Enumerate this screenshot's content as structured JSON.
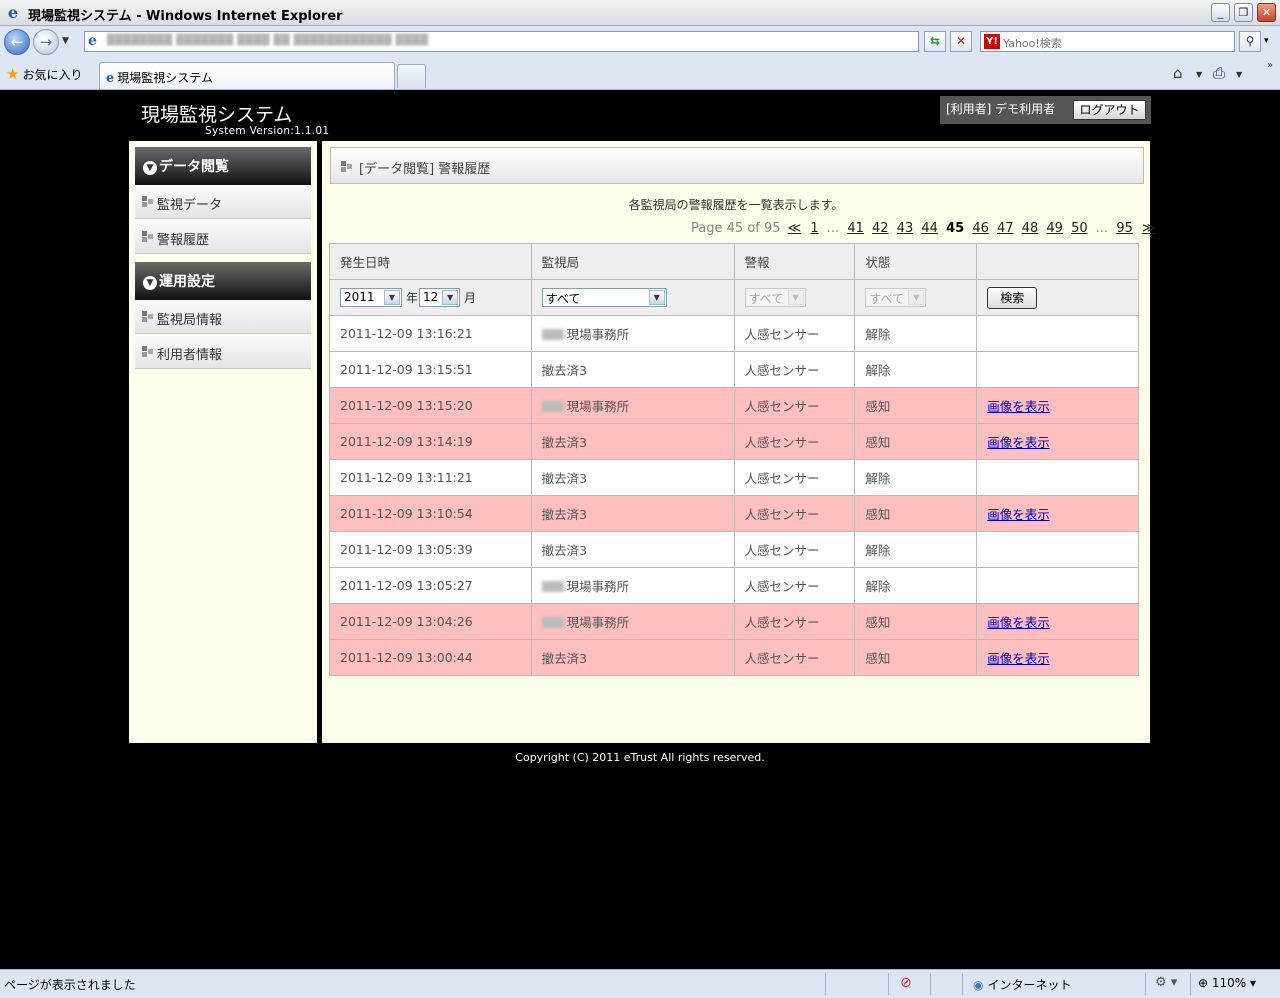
{
  "browser": {
    "window_title": "現場監視システム - Windows Internet Explorer",
    "search_placeholder": "Yahoo!検索",
    "favorites_label": "お気に入り",
    "tab_title": "現場監視システム",
    "status_text": "ページが表示されました",
    "zone_label": "インターネット",
    "zoom_label": "110%"
  },
  "header": {
    "title": "現場監視システム",
    "version": "System Version:1.1.01",
    "user_label": "[利用者] デモ利用者",
    "logout_label": "ログアウト"
  },
  "sidebar": {
    "sections": [
      {
        "title": "データ閲覧",
        "items": [
          "監視データ",
          "警報履歴"
        ]
      },
      {
        "title": "運用設定",
        "items": [
          "監視局情報",
          "利用者情報"
        ]
      }
    ]
  },
  "content": {
    "header": "[データ閲覧] 警報履歴",
    "description": "各監視局の警報履歴を一覧表示します。",
    "pager": {
      "summary": "Page 45 of 95",
      "prev_symbol": "≪",
      "next_symbol": "≫",
      "first": "1",
      "ellipsis": "...",
      "before": [
        "41",
        "42",
        "43",
        "44"
      ],
      "current": "45",
      "after": [
        "46",
        "47",
        "48",
        "49",
        "50"
      ],
      "last": "95"
    },
    "table": {
      "columns": [
        "発生日時",
        "監視局",
        "警報",
        "状態",
        ""
      ],
      "filters": {
        "year": "2011",
        "year_unit": "年",
        "month": "12",
        "month_unit": "月",
        "station": "すべて",
        "alarm": "すべて",
        "state": "すべて",
        "search_button": "検索"
      },
      "rows": [
        {
          "datetime": "2011-12-09 13:16:21",
          "station": "現場事務所",
          "station_masked": true,
          "alarm": "人感センサー",
          "state": "解除",
          "link": "",
          "alert": false
        },
        {
          "datetime": "2011-12-09 13:15:51",
          "station": "撤去済3",
          "station_masked": false,
          "alarm": "人感センサー",
          "state": "解除",
          "link": "",
          "alert": false
        },
        {
          "datetime": "2011-12-09 13:15:20",
          "station": "現場事務所",
          "station_masked": true,
          "alarm": "人感センサー",
          "state": "感知",
          "link": "画像を表示",
          "alert": true
        },
        {
          "datetime": "2011-12-09 13:14:19",
          "station": "撤去済3",
          "station_masked": false,
          "alarm": "人感センサー",
          "state": "感知",
          "link": "画像を表示",
          "alert": true
        },
        {
          "datetime": "2011-12-09 13:11:21",
          "station": "撤去済3",
          "station_masked": false,
          "alarm": "人感センサー",
          "state": "解除",
          "link": "",
          "alert": false
        },
        {
          "datetime": "2011-12-09 13:10:54",
          "station": "撤去済3",
          "station_masked": false,
          "alarm": "人感センサー",
          "state": "感知",
          "link": "画像を表示",
          "alert": true
        },
        {
          "datetime": "2011-12-09 13:05:39",
          "station": "撤去済3",
          "station_masked": false,
          "alarm": "人感センサー",
          "state": "解除",
          "link": "",
          "alert": false
        },
        {
          "datetime": "2011-12-09 13:05:27",
          "station": "現場事務所",
          "station_masked": true,
          "alarm": "人感センサー",
          "state": "解除",
          "link": "",
          "alert": false
        },
        {
          "datetime": "2011-12-09 13:04:26",
          "station": "現場事務所",
          "station_masked": true,
          "alarm": "人感センサー",
          "state": "感知",
          "link": "画像を表示",
          "alert": true
        },
        {
          "datetime": "2011-12-09 13:00:44",
          "station": "撤去済3",
          "station_masked": false,
          "alarm": "人感センサー",
          "state": "感知",
          "link": "画像を表示",
          "alert": true
        }
      ]
    }
  },
  "footer": {
    "copyright": "Copyright (C) 2011 eTrust All rights reserved."
  },
  "colors": {
    "alert_row": "#ffbfbf",
    "content_bg": "#fdfde9",
    "page_bg": "#000000"
  }
}
